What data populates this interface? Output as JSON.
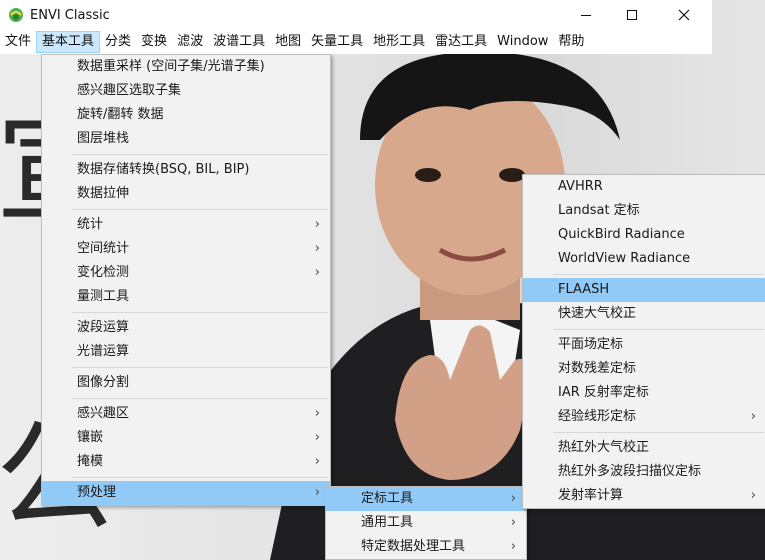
{
  "window": {
    "title": "ENVI Classic",
    "icon": "envi-app-icon",
    "controls": {
      "minimize": "minimize-icon",
      "maximize": "maximize-icon",
      "close": "close-icon"
    }
  },
  "menubar": [
    "文件",
    "基本工具",
    "分类",
    "变换",
    "滤波",
    "波谱工具",
    "地图",
    "矢量工具",
    "地形工具",
    "雷达工具",
    "Window",
    "帮助"
  ],
  "background": {
    "glyphs": [
      "宣",
      "公"
    ]
  },
  "menus": {
    "basic_tools": {
      "groups": [
        [
          "数据重采样 (空间子集/光谱子集)",
          "感兴趣区选取子集",
          "旋转/翻转 数据",
          "图层堆栈"
        ],
        [
          "数据存储转换(BSQ, BIL, BIP)",
          "数据拉伸"
        ],
        [
          "统计",
          "空间统计",
          "变化检测",
          "量测工具"
        ],
        [
          "波段运算",
          "光谱运算"
        ],
        [
          "图像分割"
        ],
        [
          "感兴趣区",
          "镶嵌",
          "掩模"
        ],
        [
          "预处理"
        ]
      ]
    },
    "preprocess": {
      "items": [
        "定标工具",
        "通用工具",
        "特定数据处理工具"
      ]
    },
    "calibration": {
      "groups": [
        [
          "AVHRR",
          "Landsat 定标",
          "QuickBird Radiance",
          "WorldView Radiance"
        ],
        [
          "FLAASH",
          "快速大气校正"
        ],
        [
          "平面场定标",
          "对数残差定标",
          "IAR 反射率定标",
          "经验线形定标"
        ],
        [
          "热红外大气校正",
          "热红外多波段扫描仪定标",
          "发射率计算"
        ]
      ]
    }
  },
  "colors": {
    "highlight": "#91c9f7",
    "menu_bg": "#f2f2f2",
    "menubar_active": "#cce8ff"
  }
}
